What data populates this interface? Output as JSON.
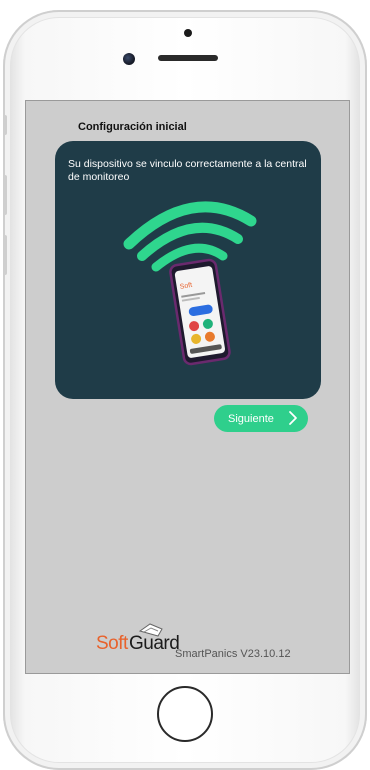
{
  "screen": {
    "title": "Configuración inicial",
    "card": {
      "message": "Su dispositivo se vinculo correctamente a la central de monitoreo",
      "background": "#1f3c48",
      "signal_color": "#2fd68e",
      "illustration_icon": "phone-with-wifi-signal"
    },
    "next_button": {
      "label": "Siguiente",
      "icon": "chevron-right-icon",
      "color": "#2fcf8c"
    },
    "footer": {
      "logo_text_1": "Soft",
      "logo_text_2": "Guard",
      "version": "SmartPanics V23.10.12",
      "brand_color": "#e8622c"
    }
  }
}
